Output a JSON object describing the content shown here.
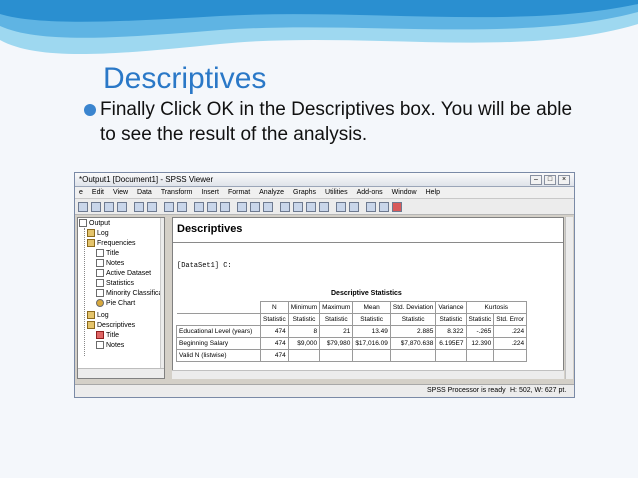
{
  "slide": {
    "title": "Descriptives",
    "bullet": "Finally Click OK in the Descriptives box. You will be able to see the result of the analysis."
  },
  "window": {
    "title": "*Output1 [Document1] - SPSS Viewer",
    "menu": [
      "e",
      "Edit",
      "View",
      "Data",
      "Transform",
      "Insert",
      "Format",
      "Analyze",
      "Graphs",
      "Utilities",
      "Add-ons",
      "Window",
      "Help"
    ]
  },
  "outline": {
    "items": [
      "Output",
      "Log",
      "Frequencies",
      "Title",
      "Notes",
      "Active Dataset",
      "Statistics",
      "Minority Classificat",
      "Pie Chart",
      "Log",
      "Descriptives",
      "Title",
      "Notes"
    ]
  },
  "content": {
    "heading": "Descriptives",
    "dataset": "[DataSet1] C:",
    "table_title": "Descriptive Statistics",
    "headers": [
      "N",
      "Minimum",
      "Maximum",
      "Mean",
      "Std. Deviation",
      "Variance",
      "Kurtosis"
    ],
    "subheaders": [
      "Statistic",
      "Statistic",
      "Statistic",
      "Statistic",
      "Statistic",
      "Statistic",
      "Statistic",
      "Std. Error"
    ],
    "rows": [
      [
        "Educational Level (years)",
        "474",
        "8",
        "21",
        "13.49",
        "2.885",
        "8.322",
        "-.265",
        ".224"
      ],
      [
        "Beginning Salary",
        "474",
        "$9,000",
        "$79,980",
        "$17,016.09",
        "$7,870.638",
        "6.195E7",
        "12.390",
        ".224"
      ],
      [
        "Valid N (listwise)",
        "474",
        "",
        "",
        "",
        "",
        "",
        "",
        ""
      ]
    ]
  },
  "status": {
    "processor": "SPSS  Processor is ready",
    "dimensions": "H: 502, W: 627 pt."
  },
  "colors": {
    "title_blue": "#2a78c7",
    "bullet_blue": "#3a85cf"
  }
}
